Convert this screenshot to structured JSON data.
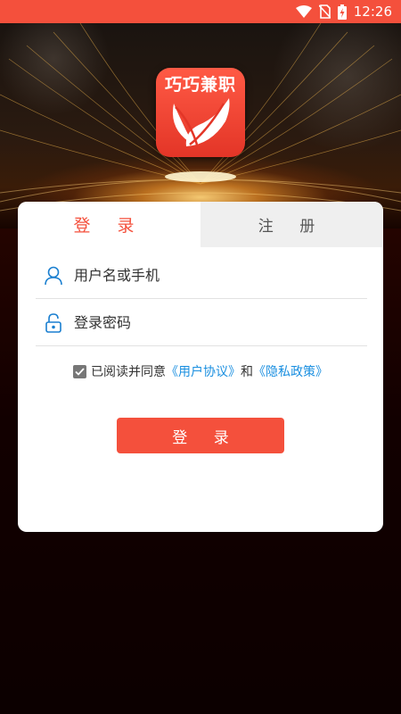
{
  "status_bar": {
    "time": "12:26"
  },
  "logo": {
    "text": "巧巧兼职"
  },
  "tabs": [
    {
      "label": "登 录",
      "active": true
    },
    {
      "label": "注 册",
      "active": false
    }
  ],
  "form": {
    "username_placeholder": "用户名或手机",
    "password_placeholder": "登录密码",
    "agreement": {
      "checked": true,
      "prefix": "已阅读并同意",
      "user_agreement": "《用户协议》",
      "conjunction": "和",
      "privacy_policy": "《隐私政策》"
    },
    "submit_label": "登 录"
  },
  "colors": {
    "accent": "#f4503c",
    "link": "#1a8fe0",
    "icon": "#1a7fd0"
  },
  "icons": [
    "wifi-icon",
    "no-sim-icon",
    "battery-charging-icon",
    "user-icon",
    "lock-icon",
    "checkbox-checked-icon",
    "leaf-logo-icon"
  ]
}
